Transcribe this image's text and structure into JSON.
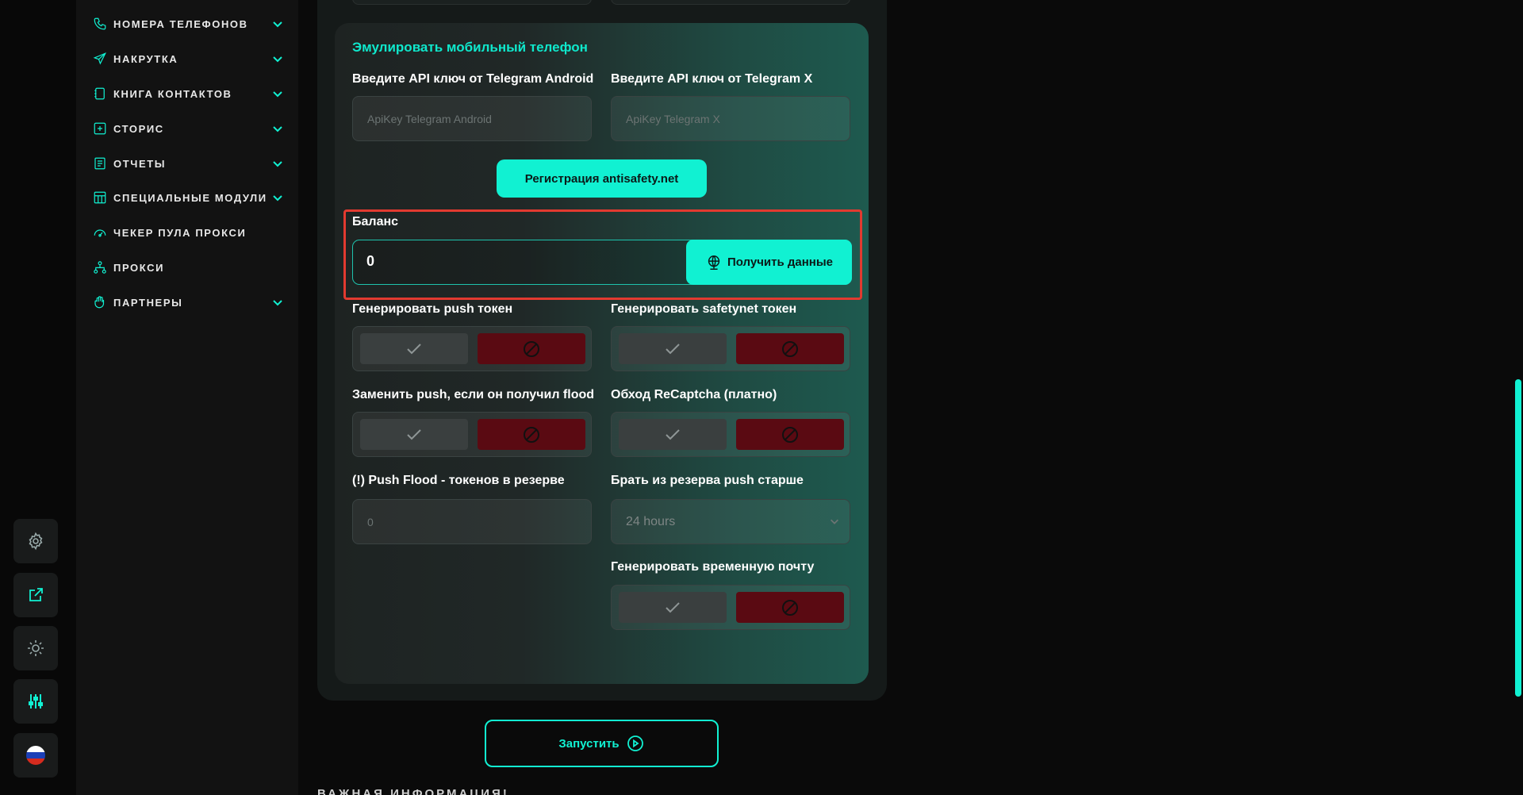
{
  "sidebar": {
    "items": [
      {
        "label": "НОМЕРА ТЕЛЕФОНОВ",
        "icon": "phone-icon",
        "has_chevron": true
      },
      {
        "label": "НАКРУТКА",
        "icon": "paper-plane-icon",
        "has_chevron": true
      },
      {
        "label": "КНИГА КОНТАКТОВ",
        "icon": "contacts-book-icon",
        "has_chevron": true
      },
      {
        "label": "СТОРИС",
        "icon": "plus-square-icon",
        "has_chevron": true
      },
      {
        "label": "ОТЧЕТЫ",
        "icon": "report-icon",
        "has_chevron": true
      },
      {
        "label": "СПЕЦИАЛЬНЫЕ МОДУЛИ",
        "icon": "modules-icon",
        "has_chevron": true
      },
      {
        "label": "ЧЕКЕР ПУЛА ПРОКСИ",
        "icon": "gauge-icon",
        "has_chevron": false
      },
      {
        "label": "ПРОКСИ",
        "icon": "network-icon",
        "has_chevron": false
      },
      {
        "label": "ПАРТНЕРЫ",
        "icon": "hand-icon",
        "has_chevron": true
      }
    ]
  },
  "rail": {
    "buttons": [
      "gear-icon",
      "external-link-icon",
      "sun-icon",
      "sliders-icon",
      "russia-flag-icon"
    ]
  },
  "emulate": {
    "title": "Эмулировать мобильный телефон",
    "api_android_label": "Введите API ключ от Telegram Android",
    "api_android_placeholder": "ApiKey Telegram Android",
    "api_x_label": "Введите API ключ от Telegram X",
    "api_x_placeholder": "ApiKey Telegram X",
    "register_button": "Регистрация antisafety.net",
    "balance_label": "Баланс",
    "balance_value": "0",
    "get_data_button": "Получить данные",
    "push_token_label": "Генерировать push токен",
    "safetynet_label": "Генерировать safetynet токен",
    "replace_push_label": "Заменить push, если он получил flood",
    "recaptcha_label": "Обход ReCaptcha (платно)",
    "push_flood_label": "(!) Push Flood - токенов в резерве",
    "push_flood_value": "0",
    "reserve_label": "Брать из резерва push старше",
    "reserve_value": "24 hours",
    "temp_mail_label": "Генерировать временную почту"
  },
  "actions": {
    "run_button": "Запустить",
    "info_heading": "ВАЖНАЯ ИНФОРМАЦИЯ!"
  },
  "colors": {
    "accent": "#11f1d2",
    "danger": "#5a0a12",
    "highlight": "#e23a30"
  }
}
